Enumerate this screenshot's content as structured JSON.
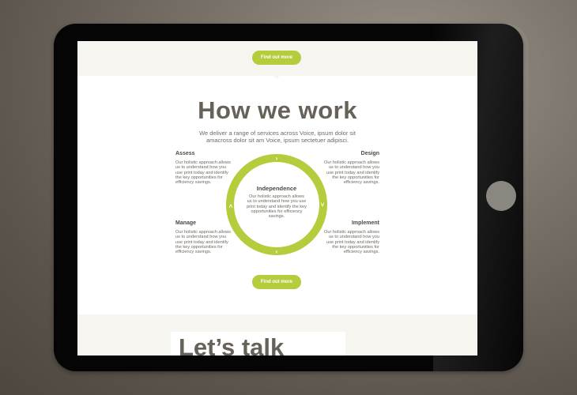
{
  "page": {
    "top_button_label": "Find out more",
    "heading": "How we work",
    "intro": "We deliver a range of services across Voice, ipsum dolor sit amacross dolor sit am Voice, ipsum sectetuer adipisci.",
    "bottom_button_label": "Find out more",
    "talk_heading": "Let’s talk"
  },
  "process": {
    "assess": {
      "title": "Assess",
      "text": "Our holistic approach allows us to understand how you use print today and identify the key opportunities for efficiency savings."
    },
    "design": {
      "title": "Design",
      "text": "Our holistic approach allows us to understand how you use print today and identify the key opportunities for efficiency savings."
    },
    "manage": {
      "title": "Manage",
      "text": "Our holistic approach allows us to understand how you use print today and identify the key opportunities for efficiency savings."
    },
    "implement": {
      "title": "Implement",
      "text": "Our holistic approach allows us to understand how you use print today and identify the key opportunities for efficiency savings."
    },
    "center": {
      "title": "Independence",
      "text": "Our holistic approach allows us to understand how you use print today and identify the key opportunities for efficiency savings."
    }
  },
  "icons": {
    "top_arrow": "›",
    "right_arrow": "˅",
    "bottom_arrow": "‹",
    "left_arrow": "˄"
  },
  "colors": {
    "accent": "#b5cc3d",
    "heading": "#666159",
    "band": "#f7f5ef"
  }
}
